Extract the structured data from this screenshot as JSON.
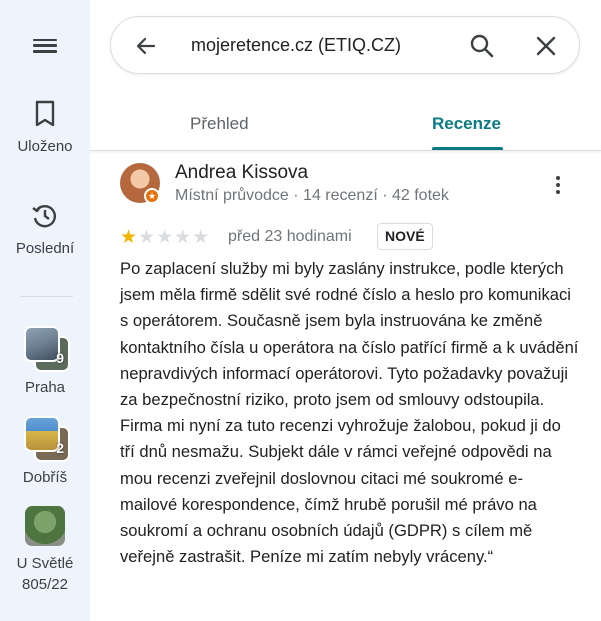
{
  "rail": {
    "saved_label": "Uloženo",
    "recent_label": "Poslední",
    "recents": [
      {
        "label": "Praha",
        "count": "9"
      },
      {
        "label": "Dobříš",
        "count": "2"
      },
      {
        "label": "U Světlé 805/22",
        "count": ""
      }
    ]
  },
  "search": {
    "query": "mojeretence.cz (ETIQ.CZ)"
  },
  "tabs": [
    {
      "label": "Přehled",
      "active": false
    },
    {
      "label": "Recenze",
      "active": true
    }
  ],
  "review": {
    "author": "Andrea Kissova",
    "meta": "Místní průvodce · 14 recenzí · 42 fotek",
    "rating": 1,
    "max_rating": 5,
    "when": "před 23 hodinami",
    "badge": "NOVÉ",
    "paragraphs": [
      "Po zaplacení služby mi byly zaslány instrukce, podle kterých jsem měla firmě sdělit své rodné číslo a heslo pro komunikaci s operátorem. Současně jsem byla instruována ke změně kontaktního čísla u operátora na číslo patřící firmě a k uvádění nepravdivých informací operátorovi. Tyto požadavky považuji za bezpečnostní riziko, proto jsem od smlouvy odstoupila.",
      "Firma mi nyní za tuto recenzi vyhrožuje žalobou, pokud ji do tří dnů nesmažu. Subjekt dále v rámci veřejné odpovědi na mou recenzi zveřejnil doslovnou citaci mé soukromé e-mailové korespondence, čímž hrubě porušil mé právo na soukromí a ochranu osobních údajů (GDPR) s cílem mě veřejně zastrašit. Peníze mi zatím nebyly vráceny.“"
    ]
  },
  "colors": {
    "accent": "#0b7b83",
    "star": "#f4b400",
    "rail_bg": "#eef4fb"
  }
}
